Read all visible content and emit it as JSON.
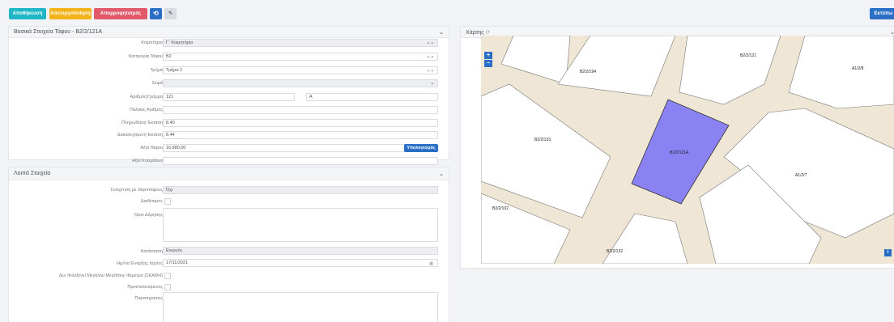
{
  "toolbar": {
    "save_label": "Αποθήκευση",
    "deactivate_label": "Απενεργοποίηση",
    "decline_label": "Απορροφητισμός",
    "right_label": "Εκτύπω"
  },
  "colors": {
    "save": "#1fb6c7",
    "deactivate": "#f2b41a",
    "decline": "#e05a6a",
    "undo": "#2a6fc5",
    "edit": "#d8dbe0",
    "parcel_highlight": "#8a82f2",
    "map_road": "#efe6d5"
  },
  "basic": {
    "title": "Βασικά Στοιχεία Τάφου - Β2/2/121Α",
    "fields": {
      "cemetery_label": "Κοιμητήριο",
      "cemetery_value": "Γ΄ Κοιμητήριο",
      "category_label": "Κατηγορία Τάφου",
      "category_value": "Β2",
      "section_label": "Τμήμα",
      "section_value": "Τμήμα 2",
      "row_label": "Σειρά",
      "row_value": "",
      "number_label": "Αριθμός/Γράμμα",
      "number_value": "121",
      "letter_value": "Α",
      "old_number_label": "Παλαιός Αριθμός",
      "sealed_area_label": "Πληρωθείσα Έκταση",
      "sealed_area_value": "8.40",
      "occupied_area_label": "Διακατεχόμενη Έκταση",
      "occupied_area_value": "8.44",
      "value_label": "Αξία Τάφου",
      "value_value": "16.880,00",
      "calc_button": "Υπολογισμός",
      "monuments_label": "Αξία Κτισμάτων"
    }
  },
  "other": {
    "title": "Λοιπά Στοιχεία",
    "fields": {
      "relation_label": "Συσχέτιση με τάφο/τάφους",
      "relation_value": "Όχι",
      "available_label": "Διαθέσιμος",
      "terms_label": "Όροι Δόμησης",
      "status_label": "Κατάσταση",
      "status_value": "Ενεργός",
      "start_label": "Ημ/νία Έναρξης Ισχύος",
      "start_value": "17/11/2021",
      "heavy_label": "Δεν Φιλοξενεί Μεγάλου Μεγέθους Φέρετρο (ΣΚΑΦΗ)",
      "protected_label": "Προστατευόμενος",
      "notes_label": "Παρατηρήσεις"
    }
  },
  "map": {
    "title": "Χάρτης",
    "parcels": [
      "Β2/2/121",
      "Α1/2/8",
      "Β2/2/194",
      "Β2/2/133",
      "Β2/2/121Α",
      "Α1/2/7",
      "Β2/2/102",
      "Β2/2/132"
    ]
  }
}
